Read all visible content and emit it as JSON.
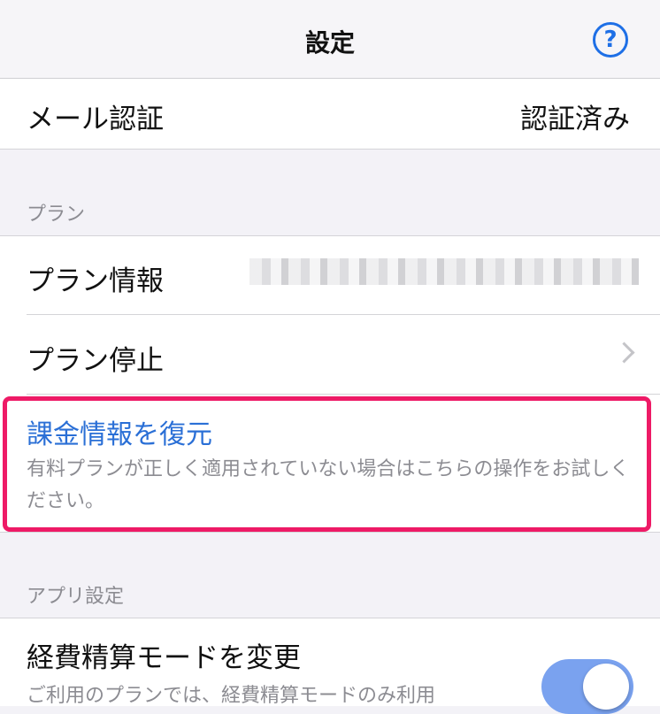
{
  "nav": {
    "title": "設定",
    "help_icon": "question-circle-icon",
    "help_glyph": "?"
  },
  "email_row": {
    "label": "メール認証",
    "value": "認証済み"
  },
  "plan_section": {
    "header": "プラン",
    "plan_info_label": "プラン情報",
    "plan_stop_label": "プラン停止",
    "restore": {
      "title": "課金情報を復元",
      "description": "有料プランが正しく適用されていない場合はこちらの操作をお試しください。"
    }
  },
  "app_section": {
    "header": "アプリ設定",
    "expense_mode": {
      "title": "経費精算モードを変更",
      "description": "ご利用のプランでは、経費精算モードのみ利用",
      "toggle_on": true
    }
  },
  "colors": {
    "accent": "#2a6fd6",
    "highlight": "#ee1a66",
    "toggle": "#7aa2ef",
    "background": "#f3f2f7"
  }
}
